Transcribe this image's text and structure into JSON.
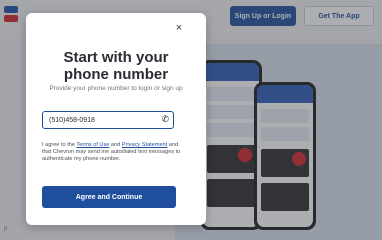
{
  "header": {
    "logo_icon": "chevron-logo-icon",
    "signup_label": "Sign Up or Login",
    "getapp_label": "Get The App"
  },
  "modal": {
    "close_icon": "close-icon",
    "close_glyph": "×",
    "title_line1": "Start with your",
    "title_line2": "phone number",
    "subtitle": "Provide your phone number to login or sign up",
    "phone_value": "(510)458-0918",
    "phone_icon": "phone-icon",
    "phone_glyph": "✆",
    "legal_prefix": "I agree to the ",
    "terms_link": "Terms of Use",
    "legal_and": " and ",
    "privacy_link": "Privacy Statement",
    "legal_suffix": " and that Chevron may send me autodialed text messages to authenticate my phone number.",
    "agree_label": "Agree and Continue"
  },
  "footer": {
    "text": "p"
  },
  "colors": {
    "brand_blue": "#1e4e9c",
    "brand_red": "#d1232a",
    "overlay": "rgba(60,62,70,0.42)"
  }
}
